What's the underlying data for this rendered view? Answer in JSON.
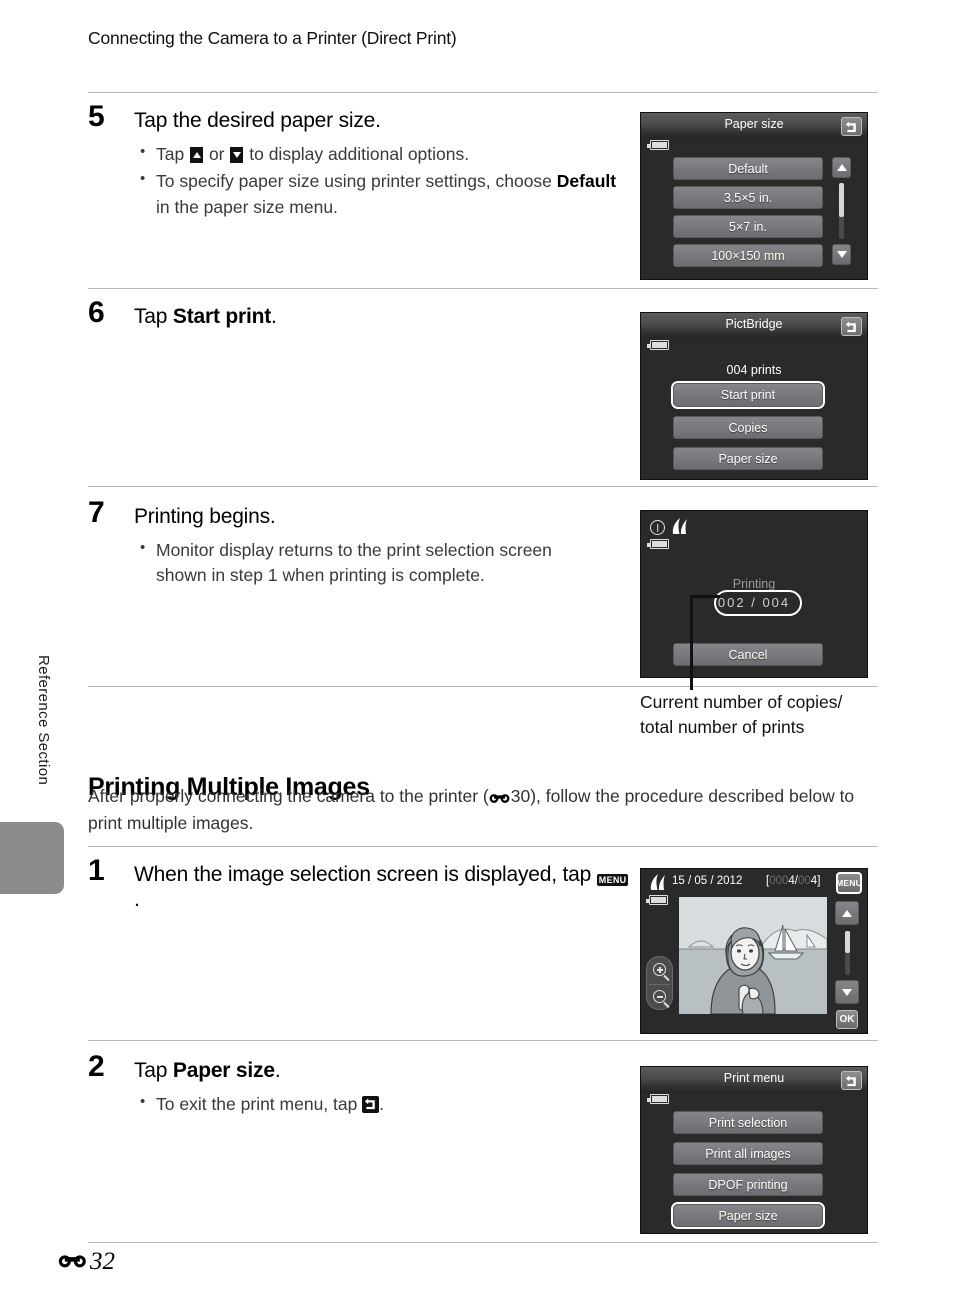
{
  "running_head": "Connecting the Camera to a Printer (Direct Print)",
  "side_tab": {
    "label": "Reference Section"
  },
  "footer": {
    "page_number": "32",
    "symbol": "e-reference-icon"
  },
  "steps": [
    {
      "number": "5",
      "title": "Tap the desired paper size.",
      "bullets_pre": "Tap ",
      "bullets": [
        {
          "parts": [
            "Tap ",
            " or ",
            " to display additional options."
          ],
          "icons": [
            "arrow-up-icon",
            "arrow-down-icon"
          ]
        },
        {
          "text_a": "To specify paper size using printer settings, choose ",
          "bold": "Default",
          "text_b": " in the paper size menu."
        }
      ]
    },
    {
      "number": "6",
      "title_a": "Tap ",
      "title_bold": "Start print",
      "title_b": "."
    },
    {
      "number": "7",
      "title": "Printing begins.",
      "bullet": "Monitor display returns to the print selection screen shown in step 1 when printing is complete."
    },
    {
      "number": "1",
      "title_a": "When the image selection screen is displayed, tap ",
      "title_icon": "MENU",
      "title_b": "."
    },
    {
      "number": "2",
      "title_a": "Tap ",
      "title_bold": "Paper size",
      "title_b": ".",
      "bullet_a": "To exit the print menu, tap ",
      "bullet_icon": "back-icon",
      "bullet_b": "."
    }
  ],
  "section": {
    "heading": "Printing Multiple Images",
    "intro_a": "After properly connecting the camera to the printer (",
    "intro_ref": "30",
    "intro_b": "), follow the procedure described below to print multiple images."
  },
  "screens": {
    "paper_size": {
      "title": "Paper size",
      "back_icon": "back-icon",
      "battery_icon": "battery-icon",
      "items": [
        "Default",
        "3.5×5 in.",
        "5×7 in.",
        "100×150 mm"
      ],
      "scroll_up_icon": "arrow-up-icon",
      "scroll_down_icon": "arrow-down-icon"
    },
    "pictbridge": {
      "title": "PictBridge",
      "back_icon": "back-icon",
      "battery_icon": "battery-icon",
      "prints_label": "004 prints",
      "items": [
        "Start print",
        "Copies",
        "Paper size"
      ],
      "selected_index": 0
    },
    "printing": {
      "warn_icon": "clock-warning-icon",
      "flame_icon": "nikon-print-icon",
      "battery_icon": "battery-icon",
      "status": "Printing",
      "current": "002",
      "separator": "/",
      "total": "004",
      "cancel_label": "Cancel",
      "callout": "Current number of copies/ total number of prints",
      "callout_line1": "Current number of copies/",
      "callout_line2": "total number of prints"
    },
    "image_selection": {
      "flame_icon": "nikon-print-icon",
      "battery_icon": "battery-icon",
      "date": "15 / 05 / 2012",
      "counter_open": "[",
      "counter_dim_a": "000",
      "counter_current": "4",
      "counter_slash": "/",
      "counter_dim_b": "00",
      "counter_total": "4",
      "counter_close": "]",
      "menu_label": "MENU",
      "ok_label": "OK",
      "zoom_in_icon": "zoom-in-icon",
      "zoom_out_icon": "zoom-out-icon",
      "scroll_up_icon": "arrow-up-icon",
      "scroll_down_icon": "arrow-down-icon"
    },
    "print_menu": {
      "title": "Print menu",
      "back_icon": "back-icon",
      "battery_icon": "battery-icon",
      "items": [
        "Print selection",
        "Print all images",
        "DPOF printing",
        "Paper size"
      ],
      "selected_index": 3
    }
  }
}
